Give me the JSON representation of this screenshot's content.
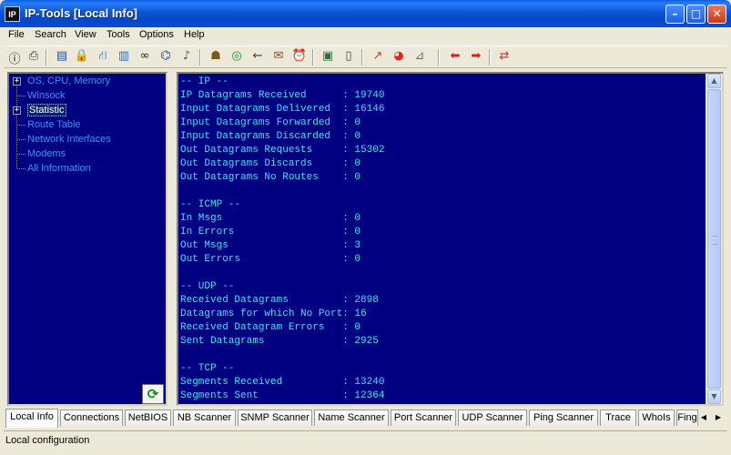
{
  "window": {
    "title": "IP-Tools [Local Info]",
    "icon_text": "IP",
    "minimize": "–",
    "maximize": "□",
    "close": "✕"
  },
  "menu": [
    "File",
    "Search",
    "View",
    "Tools",
    "Options",
    "Help"
  ],
  "toolbar_icons": [
    {
      "name": "info-icon",
      "glyph": "ⓘ",
      "color": "#000000"
    },
    {
      "name": "printer-icon",
      "glyph": "⎙",
      "color": "#333333"
    },
    {
      "name": "network-card-icon",
      "glyph": "▤",
      "color": "#2b4fa0"
    },
    {
      "name": "lock-icon",
      "glyph": "🔒",
      "color": "#8a6d1e"
    },
    {
      "name": "network-tree-icon",
      "glyph": "⛙",
      "color": "#1f63c9"
    },
    {
      "name": "book-icon",
      "glyph": "▥",
      "color": "#2c6bd8"
    },
    {
      "name": "binoculars-icon",
      "glyph": "∞",
      "color": "#222222"
    },
    {
      "name": "scanner-icon",
      "glyph": "⌬",
      "color": "#1b3f9a"
    },
    {
      "name": "speaker-icon",
      "glyph": "♪",
      "color": "#555555"
    },
    {
      "name": "computers-icon",
      "glyph": "☗",
      "color": "#7a5c1e"
    },
    {
      "name": "globe-icon",
      "glyph": "◎",
      "color": "#178a3c"
    },
    {
      "name": "trace-icon",
      "glyph": "⇜",
      "color": "#444444"
    },
    {
      "name": "mail-icon",
      "glyph": "✉",
      "color": "#b33a1b"
    },
    {
      "name": "alarm-clock-icon",
      "glyph": "⏰",
      "color": "#c0392b"
    },
    {
      "name": "monitor-icon",
      "glyph": "▣",
      "color": "#2f6f3a"
    },
    {
      "name": "document-icon",
      "glyph": "▯",
      "color": "#4a4a4a"
    },
    {
      "name": "graph-icon",
      "glyph": "↗",
      "color": "#c0392b"
    },
    {
      "name": "pie-chart-icon",
      "glyph": "◕",
      "color": "#d62d20"
    },
    {
      "name": "satellite-dish-icon",
      "glyph": "⊿",
      "color": "#6b6b6b"
    },
    {
      "name": "arrow-left-icon",
      "glyph": "⬅",
      "color": "#d61f1f"
    },
    {
      "name": "arrow-right-icon",
      "glyph": "➡",
      "color": "#d61f1f"
    },
    {
      "name": "exchange-arrows-icon",
      "glyph": "⇄",
      "color": "#c0392b"
    }
  ],
  "tree": [
    {
      "label": "OS, CPU, Memory",
      "expandable": true,
      "selected": false
    },
    {
      "label": "Winsock",
      "expandable": false,
      "selected": false
    },
    {
      "label": "Statistic",
      "expandable": true,
      "selected": true
    },
    {
      "label": "Route Table",
      "expandable": false,
      "selected": false
    },
    {
      "label": "Network Interfaces",
      "expandable": false,
      "selected": false
    },
    {
      "label": "Modems",
      "expandable": false,
      "selected": false
    },
    {
      "label": "All information",
      "expandable": false,
      "selected": false
    }
  ],
  "refresh_icon": "⟳",
  "content_lines": [
    "-- IP --",
    "IP Datagrams Received      : 19740",
    "Input Datagrams Delivered  : 16146",
    "Input Datagrams Forwarded  : 0",
    "Input Datagrams Discarded  : 0",
    "Out Datagrams Requests     : 15302",
    "Out Datagrams Discards     : 0",
    "Out Datagrams No Routes    : 0",
    "",
    "-- ICMP --",
    "In Msgs                    : 0",
    "In Errors                  : 0",
    "Out Msgs                   : 3",
    "Out Errors                 : 0",
    "",
    "-- UDP --",
    "Received Datagrams         : 2898",
    "Datagrams for which No Port: 16",
    "Received Datagram Errors   : 0",
    "Sent Datagrams             : 2925",
    "",
    "-- TCP --",
    "Segments Received          : 13240",
    "Segments Sent              : 12364"
  ],
  "scroll": {
    "up": "▲",
    "down": "▼",
    "left": "◀",
    "right": "▶"
  },
  "tabs": [
    "Local Info",
    "Connections",
    "NetBIOS",
    "NB Scanner",
    "SNMP Scanner",
    "Name Scanner",
    "Port Scanner",
    "UDP Scanner",
    "Ping Scanner",
    "Trace",
    "WhoIs",
    "Fing"
  ],
  "active_tab": "Local Info",
  "status": "Local configuration",
  "colors": {
    "pane_bg": "#000080",
    "text_cyan": "#38e6f0",
    "tree_text": "#2d98f0",
    "titlebar": "#0b56d6"
  }
}
